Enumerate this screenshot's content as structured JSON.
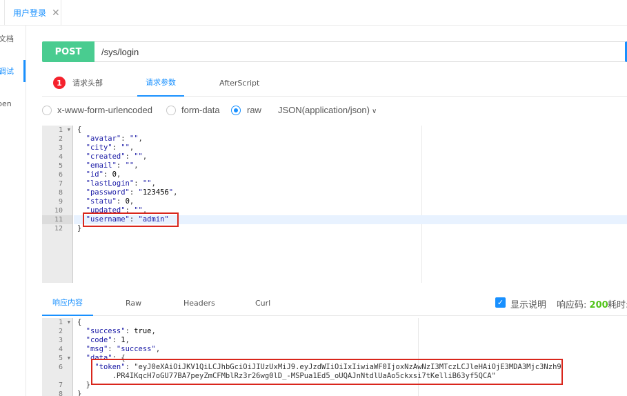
{
  "tab": {
    "label": "用户登录",
    "close": "✕"
  },
  "sidebar": [
    {
      "label": "文档"
    },
    {
      "label": "调试"
    },
    {
      "label": "pen"
    }
  ],
  "request": {
    "method": "POST",
    "url": "/sys/login"
  },
  "req_tabs": [
    {
      "label": "请求头部",
      "badge": "1"
    },
    {
      "label": "请求参数"
    },
    {
      "label": "AfterScript"
    }
  ],
  "body_types": [
    {
      "label": "x-www-form-urlencoded",
      "checked": false
    },
    {
      "label": "form-data",
      "checked": false
    },
    {
      "label": "raw",
      "checked": true
    }
  ],
  "content_type": "JSON(application/json)",
  "request_body": [
    {
      "n": "1",
      "t": "{",
      "fold": true
    },
    {
      "n": "2",
      "t": "  \"avatar\": \"\","
    },
    {
      "n": "3",
      "t": "  \"city\": \"\","
    },
    {
      "n": "4",
      "t": "  \"created\": \"\","
    },
    {
      "n": "5",
      "t": "  \"email\": \"\","
    },
    {
      "n": "6",
      "t": "  \"id\": 0,"
    },
    {
      "n": "7",
      "t": "  \"lastLogin\": \"\","
    },
    {
      "n": "8",
      "t": "  \"password\": \"123456\","
    },
    {
      "n": "9",
      "t": "  \"statu\": 0,"
    },
    {
      "n": "10",
      "t": "  \"updated\": \"\","
    },
    {
      "n": "11",
      "t": "  \"username\": \"admin\"",
      "active": true
    },
    {
      "n": "12",
      "t": "}"
    }
  ],
  "resp_tabs": [
    {
      "label": "响应内容"
    },
    {
      "label": "Raw"
    },
    {
      "label": "Headers"
    },
    {
      "label": "Curl"
    }
  ],
  "resp_meta": {
    "show_desc": "显示说明",
    "code_label": "响应码:",
    "code_value": "200",
    "time_label": "耗时:"
  },
  "response_body": [
    {
      "n": "1",
      "t": "{",
      "fold": true
    },
    {
      "n": "2",
      "t": "  \"success\": true,"
    },
    {
      "n": "3",
      "t": "  \"code\": 1,"
    },
    {
      "n": "4",
      "t": "  \"msg\": \"success\","
    },
    {
      "n": "5",
      "t": "  \"data\": {",
      "fold": true
    },
    {
      "n": "6",
      "t": "    \"token\": \"eyJ0eXAiOiJKV1QiLCJhbGciOiJIUzUxMiJ9.eyJzdWIiOiIxIiwiaWF0IjoxNzAwNzI3MTczLCJleHAiOjE3MDA3Mjc3Nzh9"
    },
    {
      "n": "",
      "t": "        .PR4IKqcH7oGU77BA7peyZmCFMblRz3r26wg0lD_-MSPua1Ed5_oUQAJnNtdlUaAo5ckxsi7tKelliB63yf5QCA\""
    },
    {
      "n": "7",
      "t": "  }"
    },
    {
      "n": "8",
      "t": "}"
    }
  ]
}
